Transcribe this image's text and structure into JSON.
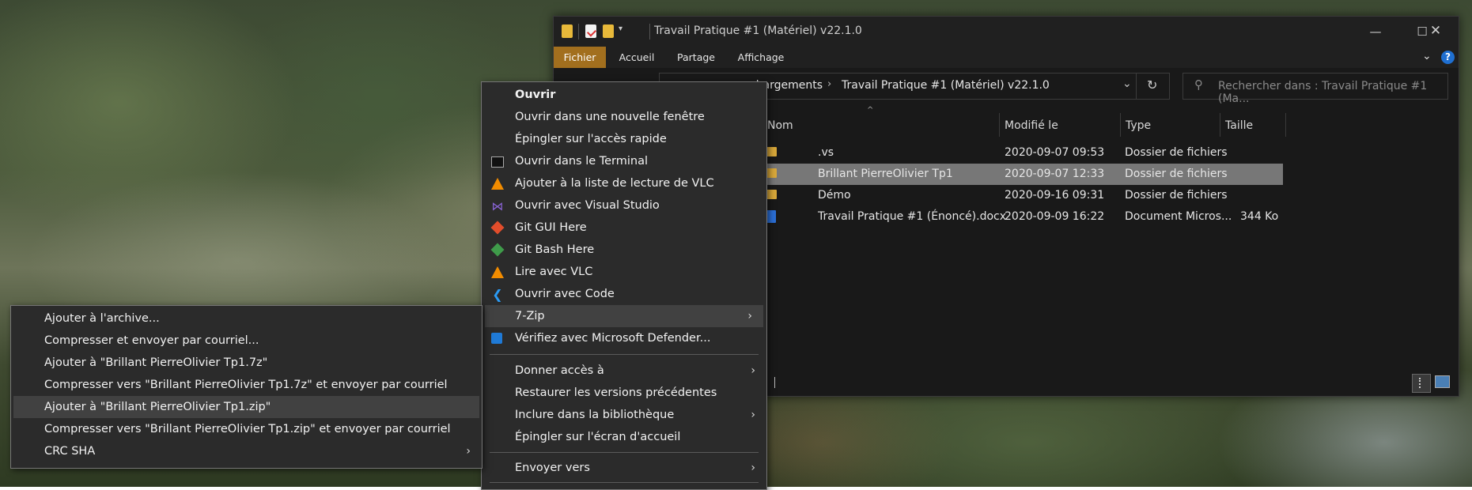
{
  "explorer": {
    "title": "Travail Pratique #1 (Matériel) v22.1.0",
    "tabs": [
      "Fichier",
      "Accueil",
      "Partage",
      "Affichage"
    ],
    "breadcrumb": [
      "chargements",
      "Travail Pratique #1 (Matériel) v22.1.0"
    ],
    "search_placeholder": "Rechercher dans : Travail Pratique #1 (Ma...",
    "columns": {
      "name": "Nom",
      "modified": "Modifié le",
      "type": "Type",
      "size": "Taille"
    },
    "files": [
      {
        "name": ".vs",
        "modified": "2020-09-07 09:53",
        "type": "Dossier de fichiers",
        "size": ""
      },
      {
        "name": "Brillant PierreOlivier Tp1",
        "modified": "2020-09-07 12:33",
        "type": "Dossier de fichiers",
        "size": ""
      },
      {
        "name": "Démo",
        "modified": "2020-09-16 09:31",
        "type": "Dossier de fichiers",
        "size": ""
      },
      {
        "name": "Travail Pratique #1 (Énoncé).docx",
        "modified": "2020-09-09 16:22",
        "type": "Document Micros...",
        "size": "344 Ko"
      }
    ],
    "help_glyph": "?"
  },
  "context_menu": {
    "items": [
      {
        "label": "Ouvrir",
        "icon": "none"
      },
      {
        "label": "Ouvrir dans une nouvelle fenêtre",
        "icon": "none"
      },
      {
        "label": "Épingler sur l'accès rapide",
        "icon": "none"
      },
      {
        "label": "Ouvrir dans le Terminal",
        "icon": "terminal-icon"
      },
      {
        "label": "Ajouter à la liste de lecture de VLC",
        "icon": "vlc-icon"
      },
      {
        "label": "Ouvrir avec Visual Studio",
        "icon": "visual-studio-icon"
      },
      {
        "label": "Git GUI Here",
        "icon": "git-gui-icon"
      },
      {
        "label": "Git Bash Here",
        "icon": "git-bash-icon"
      },
      {
        "label": "Lire avec VLC",
        "icon": "vlc-icon"
      },
      {
        "label": "Ouvrir avec Code",
        "icon": "vscode-icon"
      },
      {
        "label": "7-Zip",
        "icon": "none"
      },
      {
        "label": "Vérifiez avec Microsoft Defender...",
        "icon": "defender-icon"
      },
      {
        "label": "Donner accès à",
        "icon": "none"
      },
      {
        "label": "Restaurer les versions précédentes",
        "icon": "none"
      },
      {
        "label": "Inclure dans la bibliothèque",
        "icon": "none"
      },
      {
        "label": "Épingler sur l'écran d'accueil",
        "icon": "none"
      },
      {
        "label": "Envoyer vers",
        "icon": "none"
      }
    ]
  },
  "submenu_7zip": {
    "items": [
      "Ajouter à l'archive...",
      "Compresser et envoyer par courriel...",
      "Ajouter à \"Brillant PierreOlivier Tp1.7z\"",
      "Compresser vers \"Brillant PierreOlivier Tp1.7z\" et envoyer par courriel",
      "Ajouter à \"Brillant PierreOlivier Tp1.zip\"",
      "Compresser vers \"Brillant PierreOlivier Tp1.zip\" et envoyer par courriel",
      "CRC SHA"
    ]
  }
}
